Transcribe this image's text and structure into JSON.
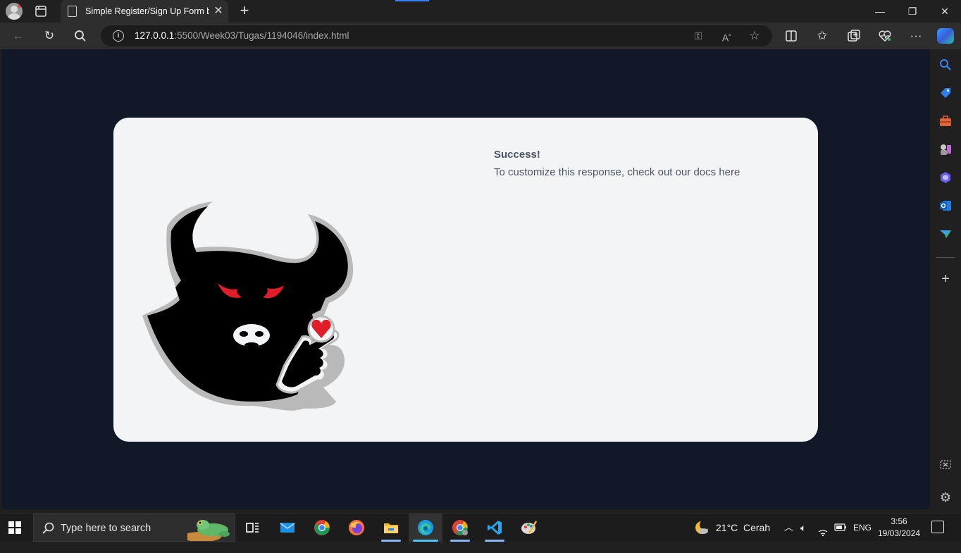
{
  "browser": {
    "tab": {
      "title": "Simple Register/Sign Up Form by"
    },
    "address": {
      "host": "127.0.0.1",
      "path": ":5500/Week03/Tugas/1194046/index.html"
    }
  },
  "page": {
    "success_title": "Success!",
    "success_message": "To customize this response, check out our docs here"
  },
  "taskbar": {
    "search_placeholder": "Type here to search",
    "weather": {
      "temp": "21°C",
      "condition": "Cerah"
    },
    "language": "ENG",
    "time": "3:56",
    "date": "19/03/2024"
  },
  "colors": {
    "page_background": "#111827",
    "card_background": "#f3f4f6",
    "text": "#4b5563",
    "eye_red": "#e11d2a",
    "heart_red": "#e11d2a"
  }
}
